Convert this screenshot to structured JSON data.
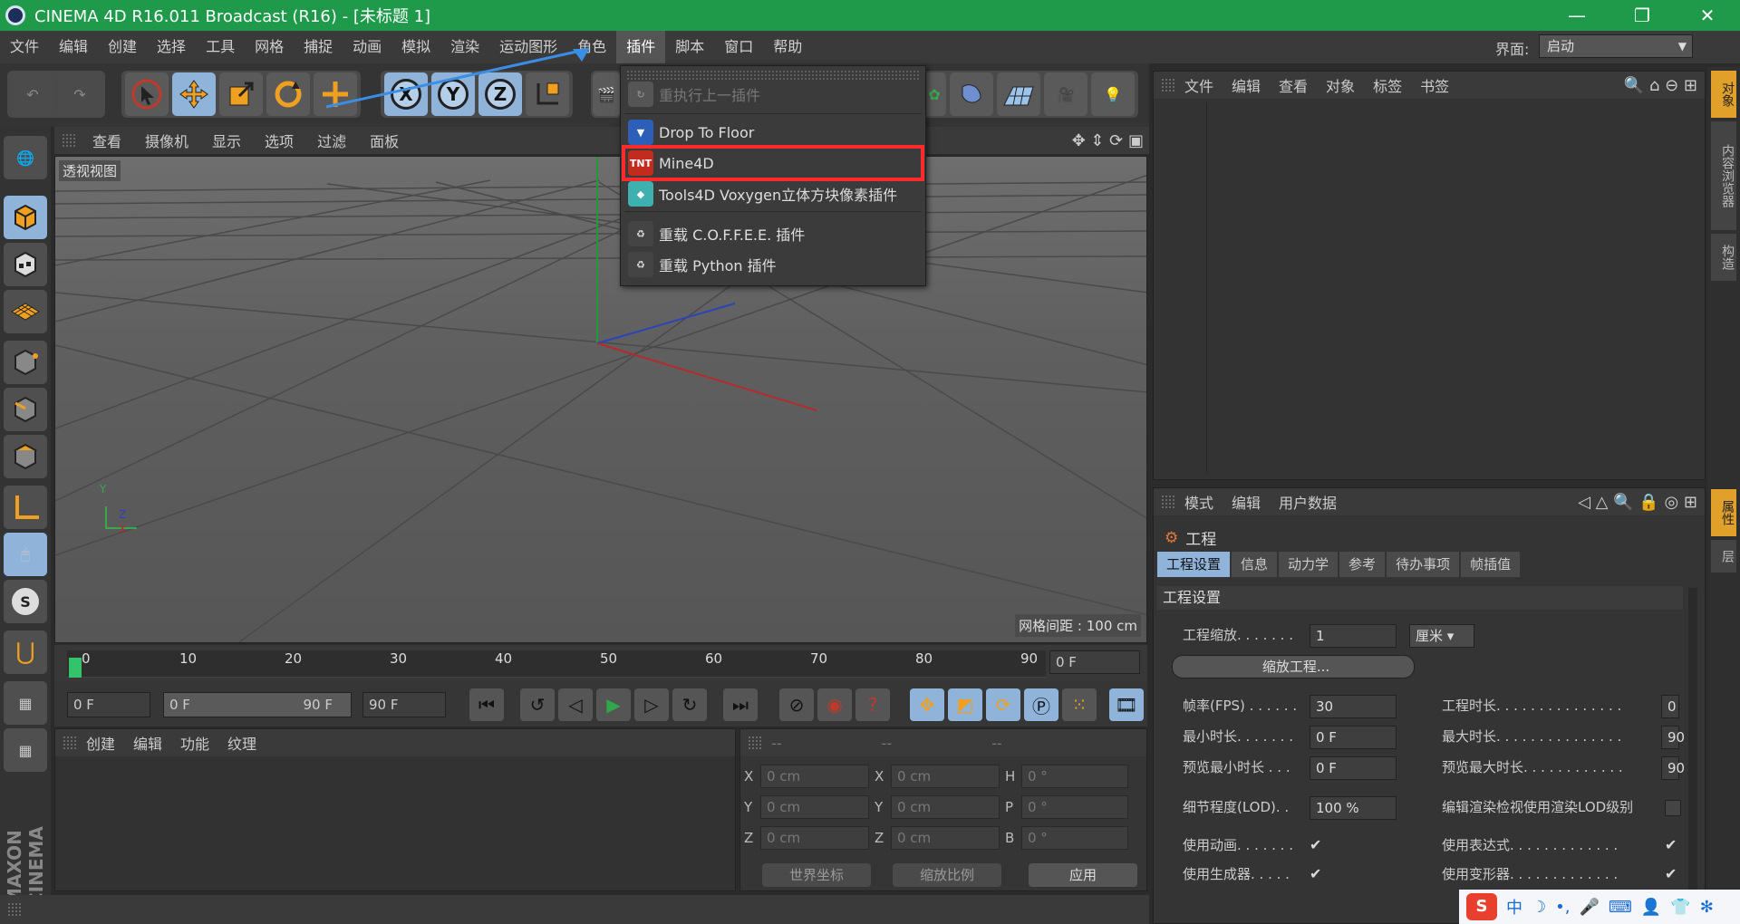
{
  "window": {
    "title": "CINEMA 4D R16.011 Broadcast (R16) - [未标题 1]",
    "minimize": "—",
    "maximize": "❐",
    "close": "✕"
  },
  "menubar": {
    "items": [
      "文件",
      "编辑",
      "创建",
      "选择",
      "工具",
      "网格",
      "捕捉",
      "动画",
      "模拟",
      "渲染",
      "运动图形",
      "角色",
      "插件",
      "脚本",
      "窗口",
      "帮助"
    ],
    "layout_label": "界面:",
    "layout_value": "启动"
  },
  "plugin_menu": {
    "items": [
      {
        "label": "重执行上一插件",
        "icon": "repeat-icon",
        "disabled": true
      },
      {
        "label": "Drop To Floor",
        "icon": "drop-to-floor-icon"
      },
      {
        "label": "Mine4D",
        "icon": "tnt-icon",
        "icon_text": "TNT"
      },
      {
        "label": "Tools4D Voxygen立体方块像素插件",
        "icon": "voxygen-icon"
      },
      {
        "label": "重载 C.O.F.F.E.E. 插件",
        "icon": "reload-icon"
      },
      {
        "label": "重载 Python 插件",
        "icon": "reload-python-icon"
      }
    ],
    "highlight_color": "#ff2b2b"
  },
  "viewport": {
    "menu": [
      "查看",
      "摄像机",
      "显示",
      "选项",
      "过滤",
      "面板"
    ],
    "label": "透视视图",
    "grid_spacing": "网格间距 : 100 cm",
    "axis_labels": {
      "y": "Y",
      "z": "Z",
      "x": "X"
    }
  },
  "timeline": {
    "ticks": [
      "0",
      "10",
      "20",
      "30",
      "40",
      "50",
      "60",
      "70",
      "80",
      "90"
    ],
    "current_frame": "0 F"
  },
  "transport": {
    "start": "0 F",
    "range_start": "0 F",
    "range_end": "90 F",
    "end": "90 F"
  },
  "material_panel": {
    "menu": [
      "创建",
      "编辑",
      "功能",
      "纹理"
    ]
  },
  "coord_panel": {
    "headers": [
      "--",
      "--",
      "--"
    ],
    "rows": [
      {
        "a": "X",
        "av": "0 cm",
        "b": "X",
        "bv": "0 cm",
        "c": "H",
        "cv": "0 °"
      },
      {
        "a": "Y",
        "av": "0 cm",
        "b": "Y",
        "bv": "0 cm",
        "c": "P",
        "cv": "0 °"
      },
      {
        "a": "Z",
        "av": "0 cm",
        "b": "Z",
        "bv": "0 cm",
        "c": "B",
        "cv": "0 °"
      }
    ],
    "world": "世界坐标",
    "scale": "缩放比例",
    "apply": "应用"
  },
  "object_panel": {
    "menu": [
      "文件",
      "编辑",
      "查看",
      "对象",
      "标签",
      "书签"
    ]
  },
  "right_strip": {
    "tabs_top": [
      "对象",
      "内容浏览器",
      "构造"
    ],
    "tabs_bottom": [
      "属性",
      "层"
    ]
  },
  "attr_panel": {
    "menu": [
      "模式",
      "编辑",
      "用户数据"
    ],
    "title": "工程",
    "tabs": [
      "工程设置",
      "信息",
      "动力学",
      "参考",
      "待办事项",
      "帧插值"
    ],
    "section": "工程设置",
    "scale_label": "工程缩放. . . . . . .",
    "scale_value": "1",
    "unit_value": "厘米",
    "scale_button": "缩放工程...",
    "fps_label": "帧率(FPS) . . . . . .",
    "fps_value": "30",
    "proj_len_label": "工程时长. . . . . . . . . . . . . . .",
    "proj_len_value": "0",
    "min_len_label": "最小时长. . . . . . .",
    "min_len_value": "0 F",
    "max_len_label": "最大时长. . . . . . . . . . . . . . .",
    "max_len_value": "90",
    "prev_min_label": "预览最小时长 . . .",
    "prev_min_value": "0 F",
    "prev_max_label": "预览最大时长. . . . . . . . . . . .",
    "prev_max_value": "90",
    "lod_label": "细节程度(LOD). .",
    "lod_value": "100 %",
    "lod_render_label": "编辑渲染检视使用渲染LOD级别",
    "use_anim_label": "使用动画. . . . . . .",
    "use_expr_label": "使用表达式. . . . . . . . . . . . .",
    "use_gen_label": "使用生成器. . . . .",
    "use_deform_label": "使用变形器. . . . . . . . . . . . .",
    "check": "✔"
  },
  "ime": {
    "logo": "S",
    "lang": "中",
    "items": [
      "☽",
      "•,",
      "🎤",
      "⌨",
      "👤",
      "👕",
      "✻"
    ]
  }
}
